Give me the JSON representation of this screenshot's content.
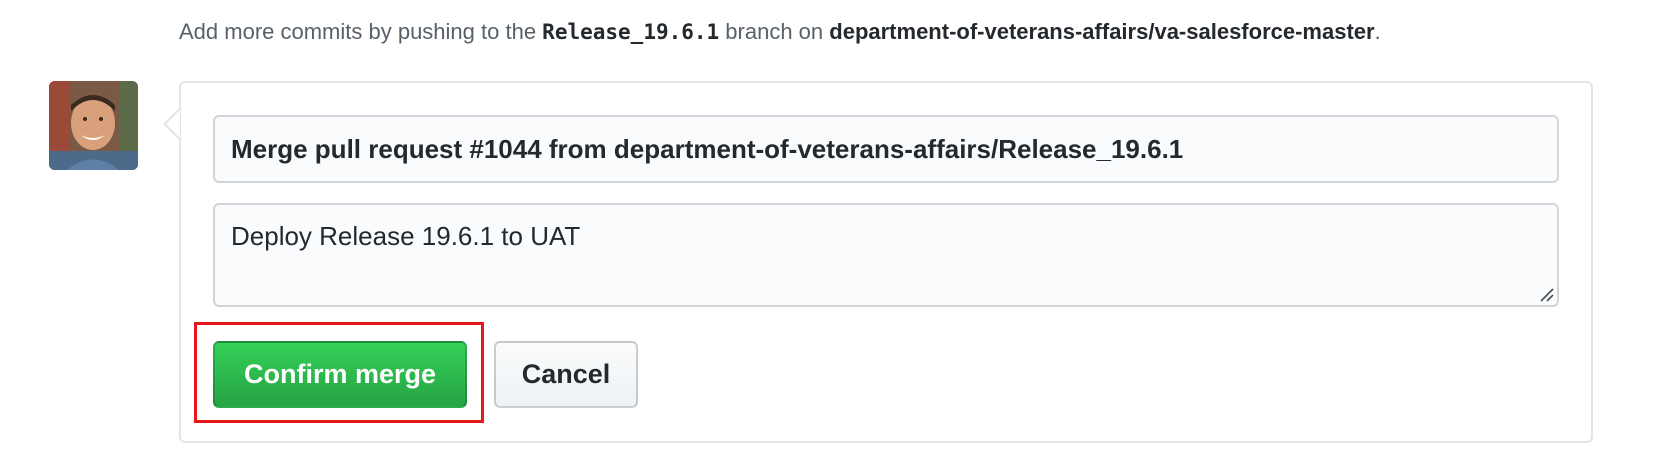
{
  "hint": {
    "prefix": "Add more commits by pushing to the ",
    "branch": "Release_19.6.1",
    "middle": " branch on ",
    "repo": "department-of-veterans-affairs/va-salesforce-master",
    "suffix": "."
  },
  "merge_form": {
    "title_value": "Merge pull request #1044 from department-of-veterans-affairs/Release_19.6.1",
    "body_value": "Deploy Release 19.6.1 to UAT",
    "confirm_label": "Confirm merge",
    "cancel_label": "Cancel"
  },
  "colors": {
    "confirm_green": "#28a745",
    "highlight_red": "#e6161b",
    "border_gray": "#e1e4e8"
  }
}
